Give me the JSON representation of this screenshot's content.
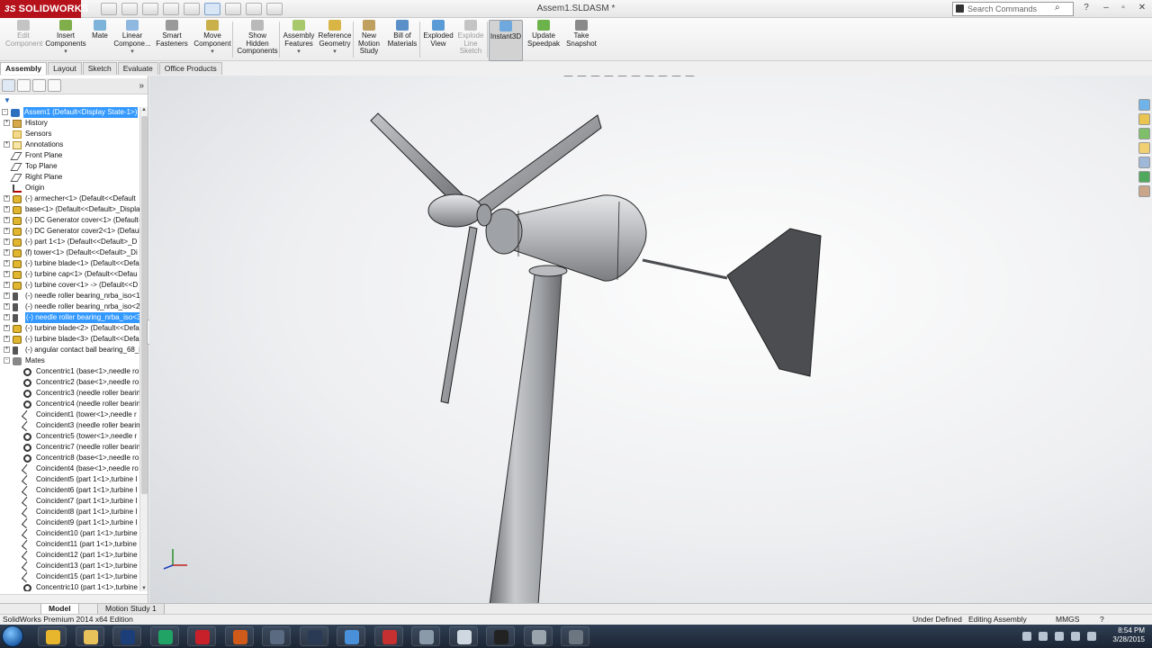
{
  "app": {
    "brand": "SOLIDWORKS",
    "brand_prefix": "3S",
    "document_title": "Assem1.SLDASM *",
    "search_placeholder": "Search Commands"
  },
  "command_manager": [
    {
      "label": "Edit Component",
      "lines": [
        "Edit",
        "Component"
      ],
      "disabled": true
    },
    {
      "label": "Insert Components",
      "lines": [
        "Insert",
        "Components"
      ],
      "disabled": false
    },
    {
      "label": "Mate",
      "lines": [
        "Mate"
      ],
      "disabled": false
    },
    {
      "label": "Linear Component",
      "lines": [
        "Linear",
        "Compone..."
      ],
      "disabled": false
    },
    {
      "label": "Smart Fasteners",
      "lines": [
        "Smart",
        "Fasteners"
      ],
      "disabled": false
    },
    {
      "label": "Move Component",
      "lines": [
        "Move",
        "Component"
      ],
      "disabled": false
    },
    {
      "label": "Show Hidden Components",
      "lines": [
        "Show",
        "Hidden",
        "Components"
      ],
      "disabled": false
    },
    {
      "label": "Assembly Features",
      "lines": [
        "Assembly",
        "Features"
      ],
      "disabled": false
    },
    {
      "label": "Reference Geometry",
      "lines": [
        "Reference",
        "Geometry"
      ],
      "disabled": false
    },
    {
      "label": "New Motion Study",
      "lines": [
        "New",
        "Motion",
        "Study"
      ],
      "disabled": false
    },
    {
      "label": "Bill of Materials",
      "lines": [
        "Bill of",
        "Materials"
      ],
      "disabled": false
    },
    {
      "label": "Exploded View",
      "lines": [
        "Exploded",
        "View"
      ],
      "disabled": false
    },
    {
      "label": "Explode Line Sketch",
      "lines": [
        "Explode",
        "Line",
        "Sketch"
      ],
      "disabled": true
    },
    {
      "label": "Instant3D",
      "lines": [
        "Instant3D"
      ],
      "disabled": false,
      "active": true
    },
    {
      "label": "Update Speedpak",
      "lines": [
        "Update",
        "Speedpak"
      ],
      "disabled": false
    },
    {
      "label": "Take Snapshot",
      "lines": [
        "Take",
        "Snapshot"
      ],
      "disabled": false
    }
  ],
  "tabs": [
    "Assembly",
    "Layout",
    "Sketch",
    "Evaluate",
    "Office Products"
  ],
  "active_tab": "Assembly",
  "tree": [
    {
      "label": "Assem1  (Default<Display State-1>)",
      "icon": "assembly",
      "indent": 0,
      "expand": "-",
      "selected": true
    },
    {
      "label": "History",
      "icon": "folder",
      "indent": 1,
      "expand": "+"
    },
    {
      "label": "Sensors",
      "icon": "sensor",
      "indent": 1,
      "expand": ""
    },
    {
      "label": "Annotations",
      "icon": "annotation",
      "indent": 1,
      "expand": "+"
    },
    {
      "label": "Front Plane",
      "icon": "plane",
      "indent": 1,
      "expand": ""
    },
    {
      "label": "Top Plane",
      "icon": "plane",
      "indent": 1,
      "expand": ""
    },
    {
      "label": "Right Plane",
      "icon": "plane",
      "indent": 1,
      "expand": ""
    },
    {
      "label": "Origin",
      "icon": "origin",
      "indent": 1,
      "expand": ""
    },
    {
      "label": "(-) armecher<1> (Default<<Default",
      "icon": "part",
      "indent": 1,
      "expand": "+"
    },
    {
      "label": "base<1> (Default<<Default>_Displa",
      "icon": "part",
      "indent": 1,
      "expand": "+"
    },
    {
      "label": "(-) DC Generator cover<1> (Default-",
      "icon": "part",
      "indent": 1,
      "expand": "+"
    },
    {
      "label": "(-) DC Generator cover2<1> (Defaul",
      "icon": "part",
      "indent": 1,
      "expand": "+"
    },
    {
      "label": "(-) part 1<1> (Default<<Default>_D",
      "icon": "part",
      "indent": 1,
      "expand": "+"
    },
    {
      "label": "(f) tower<1> (Default<<Default>_Di",
      "icon": "part",
      "indent": 1,
      "expand": "+"
    },
    {
      "label": "(-) turbine blade<1> (Default<<Defa",
      "icon": "part",
      "indent": 1,
      "expand": "+"
    },
    {
      "label": "(-) turbine cap<1> (Default<<Defau",
      "icon": "part",
      "indent": 1,
      "expand": "+"
    },
    {
      "label": "(-) turbine cover<1> -> (Default<<D",
      "icon": "part",
      "indent": 1,
      "expand": "+"
    },
    {
      "label": "(-) needle roller bearing_nrba_iso<1:",
      "icon": "toolbox",
      "indent": 1,
      "expand": "+"
    },
    {
      "label": "(-) needle roller bearing_nrba_iso<2:",
      "icon": "toolbox",
      "indent": 1,
      "expand": "+"
    },
    {
      "label": "(-) needle roller bearing_nrba_iso<3",
      "icon": "toolbox",
      "indent": 1,
      "expand": "+",
      "selected": true
    },
    {
      "label": "(-) turbine blade<2> (Default<<Defa",
      "icon": "part",
      "indent": 1,
      "expand": "+"
    },
    {
      "label": "(-) turbine blade<3> (Default<<Defa",
      "icon": "part",
      "indent": 1,
      "expand": "+"
    },
    {
      "label": "(-) angular contact ball bearing_68_i",
      "icon": "toolbox",
      "indent": 1,
      "expand": "+"
    },
    {
      "label": "Mates",
      "icon": "mates",
      "indent": 1,
      "expand": "-"
    },
    {
      "label": "Concentric1 (base<1>,needle ro",
      "icon": "concentric",
      "indent": 2,
      "expand": ""
    },
    {
      "label": "Concentric2 (base<1>,needle ro",
      "icon": "concentric",
      "indent": 2,
      "expand": ""
    },
    {
      "label": "Concentric3 (needle roller bearin",
      "icon": "concentric",
      "indent": 2,
      "expand": ""
    },
    {
      "label": "Concentric4 (needle roller bearin",
      "icon": "concentric",
      "indent": 2,
      "expand": ""
    },
    {
      "label": "Coincident1 (tower<1>,needle r",
      "icon": "coincident",
      "indent": 2,
      "expand": ""
    },
    {
      "label": "Coincident3 (needle roller bearin",
      "icon": "coincident",
      "indent": 2,
      "expand": ""
    },
    {
      "label": "Concentric5 (tower<1>,needle r",
      "icon": "concentric",
      "indent": 2,
      "expand": ""
    },
    {
      "label": "Concentric7 (needle roller bearin",
      "icon": "concentric",
      "indent": 2,
      "expand": ""
    },
    {
      "label": "Concentric8 (base<1>,needle ro",
      "icon": "concentric",
      "indent": 2,
      "expand": ""
    },
    {
      "label": "Coincident4 (base<1>,needle ro",
      "icon": "coincident",
      "indent": 2,
      "expand": ""
    },
    {
      "label": "Coincident5 (part 1<1>,turbine I",
      "icon": "coincident",
      "indent": 2,
      "expand": ""
    },
    {
      "label": "Coincident6 (part 1<1>,turbine I",
      "icon": "coincident",
      "indent": 2,
      "expand": ""
    },
    {
      "label": "Coincident7 (part 1<1>,turbine I",
      "icon": "coincident",
      "indent": 2,
      "expand": ""
    },
    {
      "label": "Coincident8 (part 1<1>,turbine I",
      "icon": "coincident",
      "indent": 2,
      "expand": ""
    },
    {
      "label": "Coincident9 (part 1<1>,turbine I",
      "icon": "coincident",
      "indent": 2,
      "expand": ""
    },
    {
      "label": "Coincident10 (part 1<1>,turbine",
      "icon": "coincident",
      "indent": 2,
      "expand": ""
    },
    {
      "label": "Coincident11 (part 1<1>,turbine",
      "icon": "coincident",
      "indent": 2,
      "expand": ""
    },
    {
      "label": "Coincident12 (part 1<1>,turbine",
      "icon": "coincident",
      "indent": 2,
      "expand": ""
    },
    {
      "label": "Coincident13 (part 1<1>,turbine",
      "icon": "coincident",
      "indent": 2,
      "expand": ""
    },
    {
      "label": "Coincident15 (part 1<1>,turbine",
      "icon": "coincident",
      "indent": 2,
      "expand": ""
    },
    {
      "label": "Concentric10 (part 1<1>,turbine",
      "icon": "concentric",
      "indent": 2,
      "expand": ""
    }
  ],
  "bottom_tabs": [
    "Model",
    "Motion Study 1"
  ],
  "status": {
    "product": "SolidWorks Premium 2014 x64 Edition",
    "definition": "Under Defined",
    "mode": "Editing Assembly",
    "units": "MMGS"
  },
  "clock": {
    "time": "8:54 PM",
    "date": "3/28/2015"
  },
  "taskbar_apps": [
    "chrome",
    "file-explorer",
    "photoshop",
    "pycharm",
    "solidworks",
    "revit",
    "obs",
    "steam",
    "qbittorrent",
    "popcorn",
    "calculator",
    "excel",
    "video-editor",
    "alienware",
    "tool"
  ],
  "colors": {
    "brand": "#b5121b",
    "selection": "#3399ff",
    "model_gray": "#a9abae"
  }
}
